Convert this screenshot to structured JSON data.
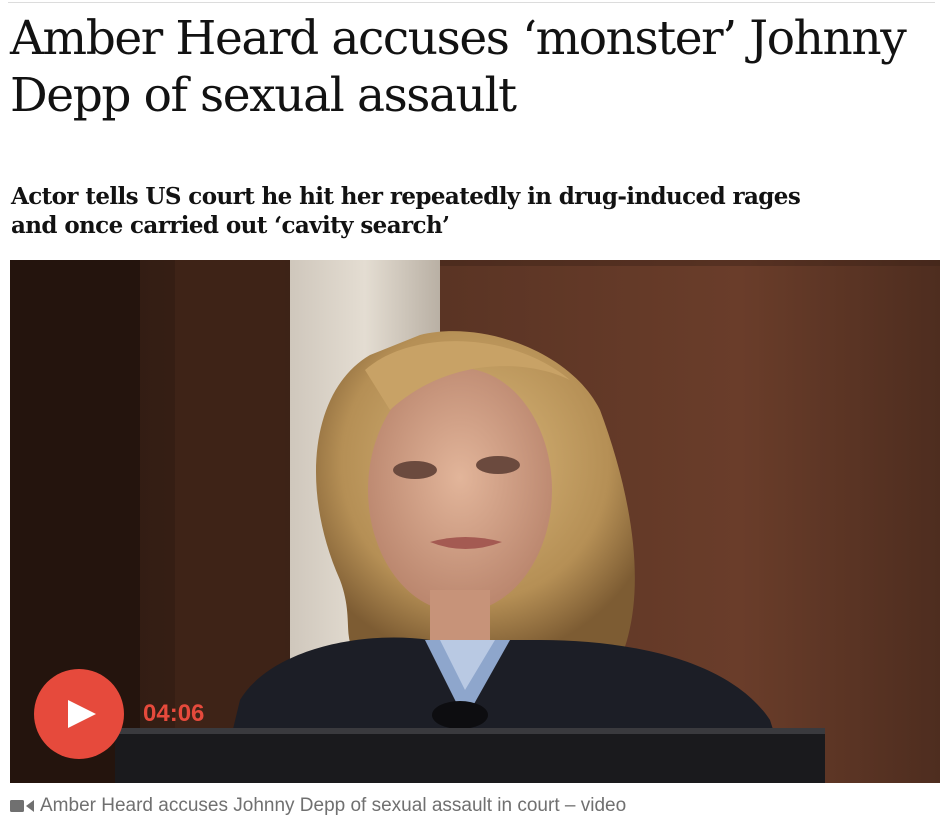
{
  "article": {
    "headline": "Amber Heard accuses ‘monster’ Johnny Depp of sexual assault",
    "standfirst": "Actor tells US court he hit her repeatedly in drug-induced rages and once carried out ‘cavity search’"
  },
  "video": {
    "duration": "04:06",
    "caption": "Amber Heard accuses Johnny Depp of sexual assault in court – video",
    "play_icon": "play-icon",
    "caption_icon": "video-camera-icon"
  },
  "colors": {
    "accent": "#e64a3c",
    "headline": "#121212",
    "caption": "#707070"
  }
}
